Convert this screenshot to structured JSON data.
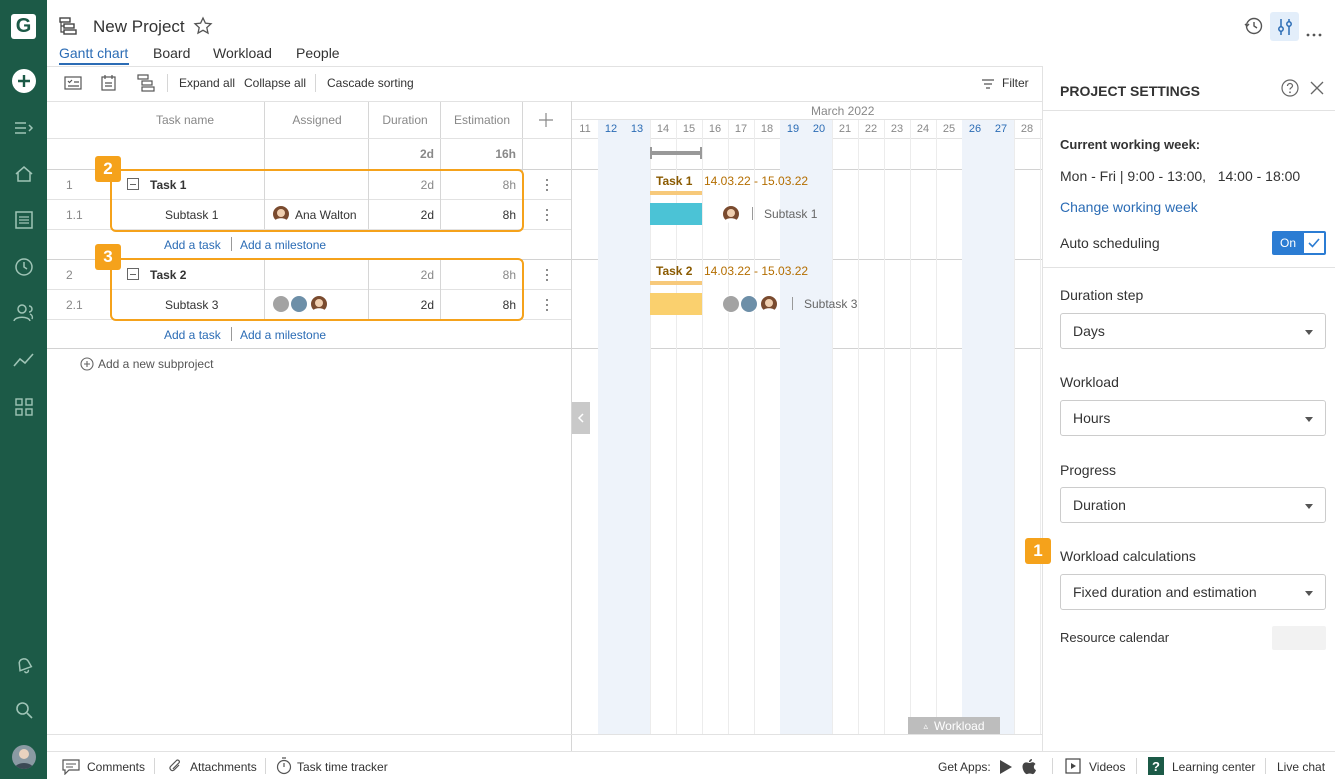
{
  "app": {
    "logo_letter": "G",
    "project_title": "New Project"
  },
  "tabs": [
    {
      "label": "Gantt chart",
      "active": true
    },
    {
      "label": "Board"
    },
    {
      "label": "Workload"
    },
    {
      "label": "People"
    }
  ],
  "toolbar": {
    "expand_all": "Expand all",
    "collapse_all": "Collapse all",
    "cascade_sorting": "Cascade sorting",
    "filter": "Filter"
  },
  "grid": {
    "headers": {
      "task_name": "Task name",
      "assigned": "Assigned",
      "duration": "Duration",
      "estimation": "Estimation"
    },
    "summary": {
      "duration": "2d",
      "estimation": "16h"
    },
    "rows": [
      {
        "num": "1",
        "name": "Task 1",
        "duration": "2d",
        "estimation": "8h"
      },
      {
        "num": "1.1",
        "name": "Subtask 1",
        "assigned": "Ana Walton",
        "duration": "2d",
        "estimation": "8h"
      },
      {
        "num": "2",
        "name": "Task 2",
        "duration": "2d",
        "estimation": "8h"
      },
      {
        "num": "2.1",
        "name": "Subtask 3",
        "duration": "2d",
        "estimation": "8h"
      }
    ],
    "add_task": "Add a task",
    "add_milestone": "Add a milestone",
    "add_subproject": "Add a new subproject"
  },
  "badges": [
    "1",
    "2",
    "3"
  ],
  "gantt": {
    "month": "March 2022",
    "days": [
      "11",
      "12",
      "13",
      "14",
      "15",
      "16",
      "17",
      "18",
      "19",
      "20",
      "21",
      "22",
      "23",
      "24",
      "25",
      "26",
      "27",
      "28"
    ],
    "weekend_days": [
      "12",
      "13",
      "19",
      "20",
      "26",
      "27"
    ],
    "task1_label": "Task 1",
    "task1_dates": "14.03.22 - 15.03.22",
    "subtask1_label": "Subtask 1",
    "task2_label": "Task 2",
    "task2_dates": "14.03.22 - 15.03.22",
    "subtask3_label": "Subtask 3",
    "workload_button": "Workload",
    "colors": {
      "subtask1": "#4bc3d6",
      "subtask3": "#fad06e",
      "task": "#f7c97a",
      "summary": "#999999"
    }
  },
  "settings": {
    "title": "PROJECT SETTINGS",
    "working_week_label": "Current working week:",
    "working_week_value": "Mon - Fri | 9:00 - 13:00,   14:00 - 18:00",
    "change_working_week": "Change working week",
    "auto_scheduling_label": "Auto scheduling",
    "auto_scheduling_toggle": "On",
    "duration_step_label": "Duration step",
    "duration_step_value": "Days",
    "workload_label": "Workload",
    "workload_value": "Hours",
    "progress_label": "Progress",
    "progress_value": "Duration",
    "workload_calc_label": "Workload calculations",
    "workload_calc_value": "Fixed duration and estimation",
    "resource_calendar_label": "Resource calendar"
  },
  "footer": {
    "comments": "Comments",
    "attachments": "Attachments",
    "time_tracker": "Task time tracker",
    "get_apps": "Get Apps:",
    "videos": "Videos",
    "learning_center": "Learning center",
    "live_chat": "Live chat"
  },
  "accent_color": "#f5a21b",
  "brand_color": "#1c5a47"
}
